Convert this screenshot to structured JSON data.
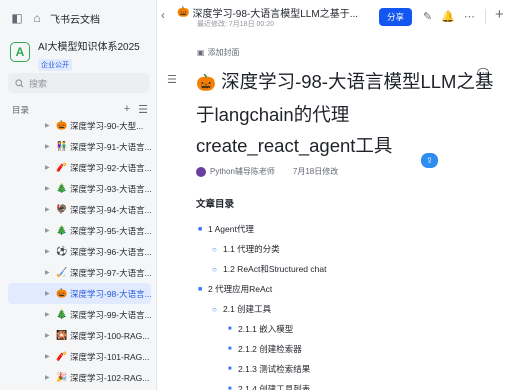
{
  "app": {
    "brand": "飞书云文档"
  },
  "knowledge_base": {
    "avatar_letter": "A",
    "title": "AI大模型知识体系2025",
    "tag": "企业公开"
  },
  "search": {
    "placeholder": "搜索"
  },
  "toc_panel": {
    "label": "目录"
  },
  "tree": [
    {
      "emoji": "🎃",
      "label": "深度学习-90-大型..."
    },
    {
      "emoji": "👫",
      "label": "深度学习-91-大语言..."
    },
    {
      "emoji": "🧨",
      "label": "深度学习-92-大语言..."
    },
    {
      "emoji": "🎄",
      "label": "深度学习-93-大语言..."
    },
    {
      "emoji": "🦃",
      "label": "深度学习-94-大语言..."
    },
    {
      "emoji": "🎄",
      "label": "深度学习-95-大语言..."
    },
    {
      "emoji": "⚽",
      "label": "深度学习-96-大语言..."
    },
    {
      "emoji": "🏑",
      "label": "深度学习-97-大语言..."
    },
    {
      "emoji": "🎃",
      "label": "深度学习-98-大语言..."
    },
    {
      "emoji": "🎄",
      "label": "深度学习-99-大语言..."
    },
    {
      "emoji": "🎇",
      "label": "深度学习-100-RAG..."
    },
    {
      "emoji": "🧨",
      "label": "深度学习-101-RAG..."
    },
    {
      "emoji": "🎉",
      "label": "深度学习-102-RAG..."
    }
  ],
  "active_index": 8,
  "topbar": {
    "title_emoji": "🎃",
    "title": "深度学习-98-大语言模型LLM之基于...",
    "subtitle": "最近修改: 7月18日 00:20",
    "share": "分享"
  },
  "doc": {
    "add_cover": "添加封面",
    "title_emoji": "🎃",
    "title": "深度学习-98-大语言模型LLM之基于langchain的代理create_react_agent工具",
    "author": "Python辅导陈老师",
    "date": "7月18日修改",
    "toc_title": "文章目录",
    "toc": [
      {
        "level": 1,
        "text": "1 Agent代理"
      },
      {
        "level": 2,
        "text": "1.1 代理的分类"
      },
      {
        "level": 2,
        "text": "1.2 ReAct和Structured chat"
      },
      {
        "level": 1,
        "text": "2 代理应用ReAct"
      },
      {
        "level": 2,
        "text": "2.1 创建工具"
      },
      {
        "level": 3,
        "text": "2.1.1 嵌入模型"
      },
      {
        "level": 3,
        "text": "2.1.2 创建检索器"
      },
      {
        "level": 3,
        "text": "2.1.3 测试检索结果"
      },
      {
        "level": 3,
        "text": "2.1.4 创建工具列表"
      }
    ]
  },
  "colors": {
    "accent": "#1456f0",
    "active_bg": "#e1eaff",
    "kb_green": "#34a853"
  }
}
